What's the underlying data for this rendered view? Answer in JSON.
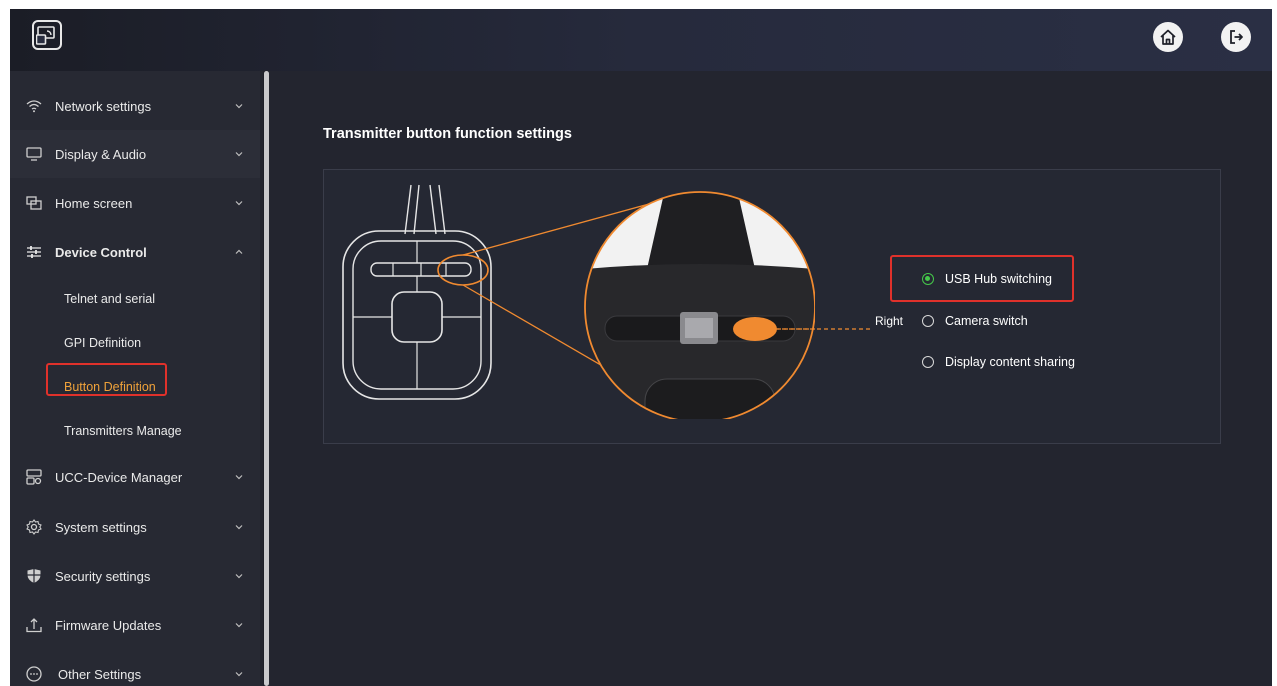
{
  "sidebar": {
    "items": [
      {
        "label": "Network settings",
        "icon": "wifi-icon"
      },
      {
        "label": "Display & Audio",
        "icon": "monitor-icon"
      },
      {
        "label": "Home screen",
        "icon": "windows-icon"
      },
      {
        "label": "Device Control",
        "icon": "sliders-icon"
      },
      {
        "label": "UCC-Device Manager",
        "icon": "device-manager-icon"
      },
      {
        "label": "System settings",
        "icon": "gear-icon"
      },
      {
        "label": "Security settings",
        "icon": "shield-icon"
      },
      {
        "label": "Firmware Updates",
        "icon": "upload-icon"
      },
      {
        "label": "Other Settings",
        "icon": "more-icon"
      }
    ],
    "device_control_sub": [
      {
        "label": "Telnet and serial"
      },
      {
        "label": "GPI Definition"
      },
      {
        "label": "Button Definition"
      },
      {
        "label": "Transmitters Manage"
      }
    ]
  },
  "main": {
    "title": "Transmitter button function settings",
    "side_label": "Right",
    "options": [
      {
        "label": "USB Hub switching",
        "selected": true
      },
      {
        "label": "Camera switch",
        "selected": false
      },
      {
        "label": "Display content sharing",
        "selected": false
      }
    ]
  },
  "colors": {
    "accent": "#f0a23a",
    "highlight": "#e0312b",
    "radio_on": "#45c84a"
  }
}
